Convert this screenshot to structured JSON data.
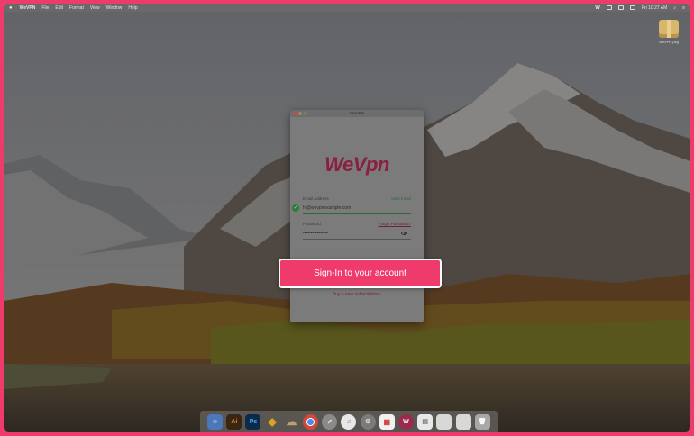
{
  "menubar": {
    "app_name": "WeVPN",
    "menu_items": [
      "File",
      "Edit",
      "Format",
      "View",
      "Window",
      "Help"
    ],
    "clock": "Fri 10:27 AM"
  },
  "desktop": {
    "file_label": "WeVPN.pkg"
  },
  "app_window": {
    "title": "WeVPN",
    "logo_text": "WeVpn",
    "email_label": "Email Address",
    "email_status": "Valid Email",
    "email_value": "hi@wevpnexample.com",
    "password_label": "Password",
    "forgot_password": "Forgot Password?",
    "password_value": "••••••••••••••••",
    "subscribe_link": "Buy a new subscription ›"
  },
  "signin": {
    "label": "Sign-In to your account"
  },
  "dock": {
    "items": [
      "Ai",
      "Ps",
      "W"
    ]
  },
  "colors": {
    "accent": "#ef3a6c",
    "logo": "#8a1f3f",
    "valid": "#2f7a3a"
  }
}
